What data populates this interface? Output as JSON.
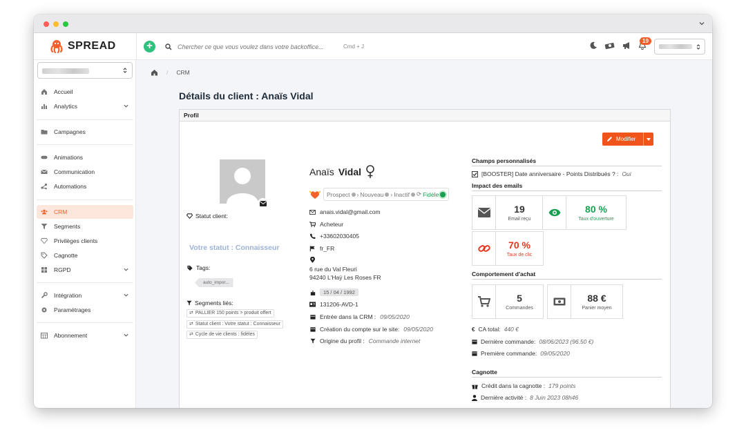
{
  "app": {
    "logo": "SPREAD",
    "search_placeholder": "Chercher ce que vous voulez dans votre backoffice...",
    "search_shortcut": "Cmd + J",
    "notifications": "19"
  },
  "sidebar": {
    "items": [
      {
        "label": "Accueil"
      },
      {
        "label": "Analytics"
      },
      {
        "label": "Campagnes"
      },
      {
        "label": "Animations"
      },
      {
        "label": "Communication"
      },
      {
        "label": "Automations"
      },
      {
        "label": "CRM"
      },
      {
        "label": "Segments"
      },
      {
        "label": "Privilèges clients"
      },
      {
        "label": "Cagnotte"
      },
      {
        "label": "RGPD"
      },
      {
        "label": "Intégration"
      },
      {
        "label": "Paramétrages"
      },
      {
        "label": "Abonnement"
      }
    ]
  },
  "breadcrumb": {
    "current": "CRM"
  },
  "page": {
    "title": "Détails du client : Anaïs Vidal",
    "card_title": "Profil",
    "modify_label": "Modifier"
  },
  "client": {
    "first_name": "Anaïs",
    "last_name": "Vidal",
    "status_label": "Statut client:",
    "status_value": "Votre statut : Connaisseur",
    "tags_label": "Tags:",
    "tags": [
      "auto_impor..."
    ],
    "segments_label": "Segments liés:",
    "segments": [
      "PALLIER 150 points > produit offert",
      "Statut client : Votre statut : Connaisseur",
      "Cycle de vie clients : fidèles"
    ],
    "lifecycle": [
      "Prospect",
      "Nouveau",
      "Inactif",
      "Fidèle"
    ],
    "email": "anais.vidal@gmail.com",
    "type": "Acheteur",
    "phone": "+33602030405",
    "locale": "fr_FR",
    "address_line1": "6 rue du Val Fleuri",
    "address_line2": "94240 L'Haÿ Les Roses FR",
    "birthday": "15 / 04 / 1992",
    "id": "131206-AVD-1",
    "crm_entry_label": "Entrée dans la CRM :",
    "crm_entry": "09/05/2020",
    "account_created_label": "Création du compte sur le site:",
    "account_created": "09/05/2020",
    "origin_label": "Origine du profil :",
    "origin": "Commande internet"
  },
  "custom_fields": {
    "title": "Champs personnalisés",
    "field_label": "[BOOSTER] Date anniversaire - Points Distribués ? :",
    "field_value": "Oui"
  },
  "email_impact": {
    "title": "Impact des emails",
    "received": {
      "value": "19",
      "label": "Email reçu"
    },
    "open": {
      "value": "80 %",
      "label": "Taux d'ouverture"
    },
    "click": {
      "value": "70 %",
      "label": "Taux de clic"
    }
  },
  "purchase": {
    "title": "Comportement d'achat",
    "orders": {
      "value": "5",
      "label": "Commandes"
    },
    "basket": {
      "value": "88 €",
      "label": "Panier moyen"
    },
    "ca_label": "CA total:",
    "ca": "440 €",
    "last_label": "Dernière commande:",
    "last": "08/06/2023 (96.50 €)",
    "first_label": "Première commande:",
    "first": "09/05/2020"
  },
  "cagnotte": {
    "title": "Cagnotte",
    "credit_label": "Crédit dans la cagnotte :",
    "credit": "179 points",
    "activity_label": "Dernière activité :",
    "activity": "8 Juin 2023 08h46"
  },
  "colors": {
    "accent": "#f0541b",
    "green": "#1a9f52",
    "red": "#e8341c",
    "status": "#9db2d6"
  }
}
